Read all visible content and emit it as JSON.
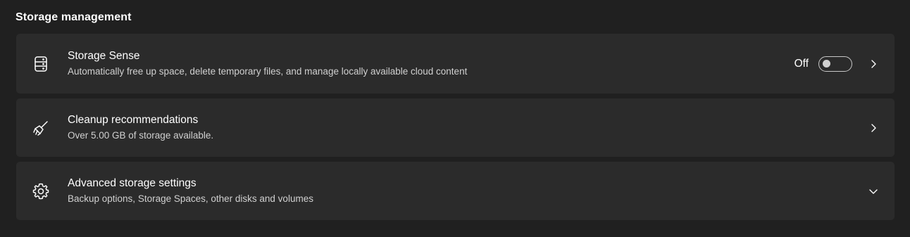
{
  "section": {
    "title": "Storage management"
  },
  "items": [
    {
      "icon": "storage-drive-icon",
      "title": "Storage Sense",
      "description": "Automatically free up space, delete temporary files, and manage locally available cloud content",
      "toggle_label": "Off",
      "toggle_state": "off",
      "action_icon": "chevron-right-icon"
    },
    {
      "icon": "broom-icon",
      "title": "Cleanup recommendations",
      "description": "Over 5.00 GB of storage available.",
      "action_icon": "chevron-right-icon"
    },
    {
      "icon": "gear-icon",
      "title": "Advanced storage settings",
      "description": "Backup options, Storage Spaces, other disks and volumes",
      "action_icon": "chevron-down-icon"
    }
  ]
}
